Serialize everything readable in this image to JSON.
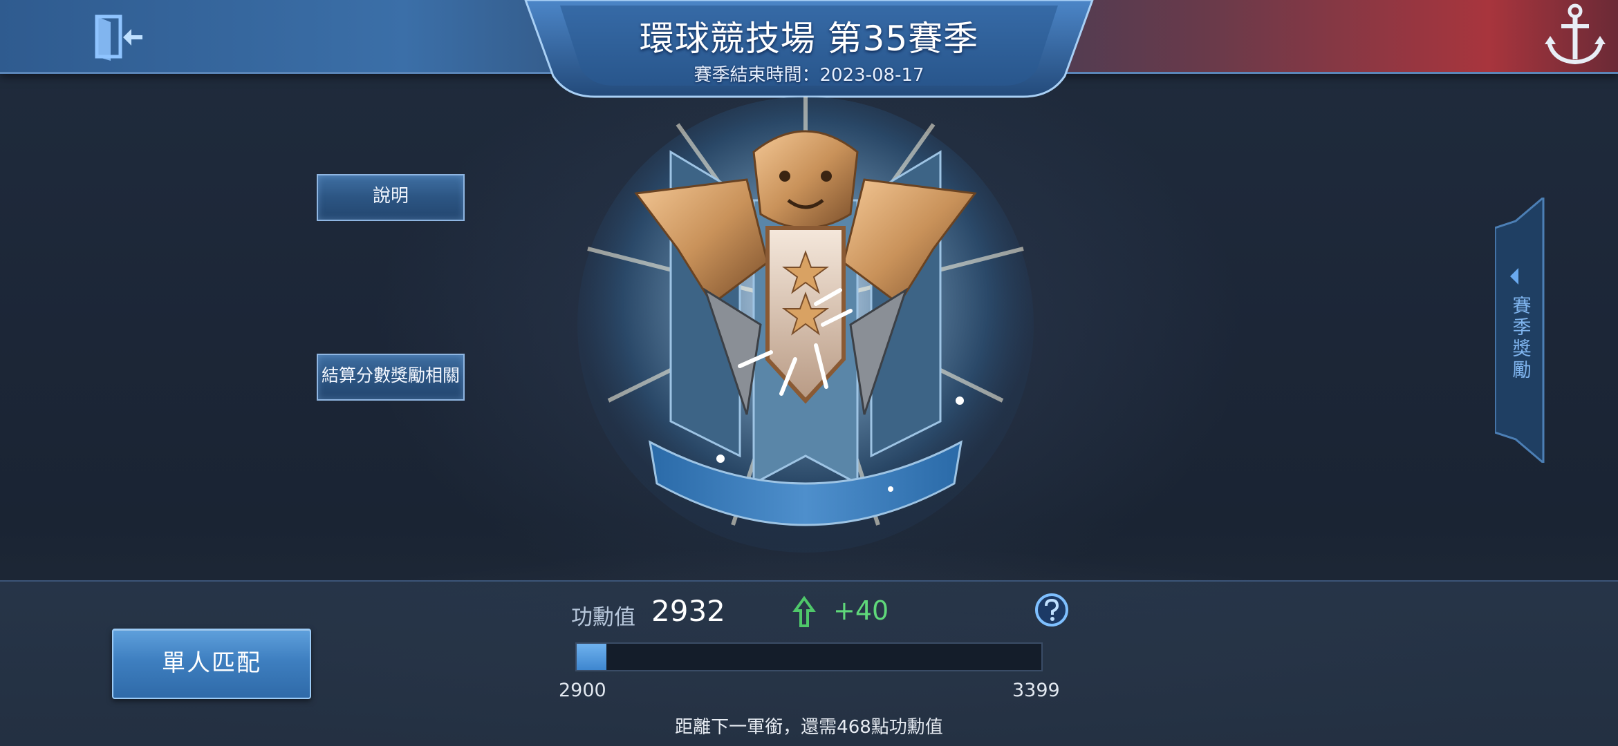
{
  "header": {
    "title": "環球競技場 第35賽季",
    "season_end": "賽季結束時間：2023-08-17"
  },
  "left_panel": {
    "explain_label": "說明",
    "rewards_label": "結算分數獎勵相關"
  },
  "right_tab": {
    "label": "賽季獎勵"
  },
  "merit": {
    "label": "功勳值",
    "value": "2932",
    "gain": "+40",
    "range_min": "2900",
    "range_max": "3399",
    "progress": 0.064,
    "next_rank_text": "距離下一軍銜，還需468點功勳值"
  },
  "match": {
    "solo_label": "單人匹配"
  },
  "icons": {
    "exit": "exit-door-icon",
    "anchor": "anchor-icon",
    "help": "question-icon",
    "gain": "up-arrow-icon",
    "tab_arrow": "triangle-left-icon"
  },
  "colors": {
    "accent_blue": "#3e86cf",
    "gain_green": "#5fd87a",
    "emblem_gold": "#c9925a"
  }
}
